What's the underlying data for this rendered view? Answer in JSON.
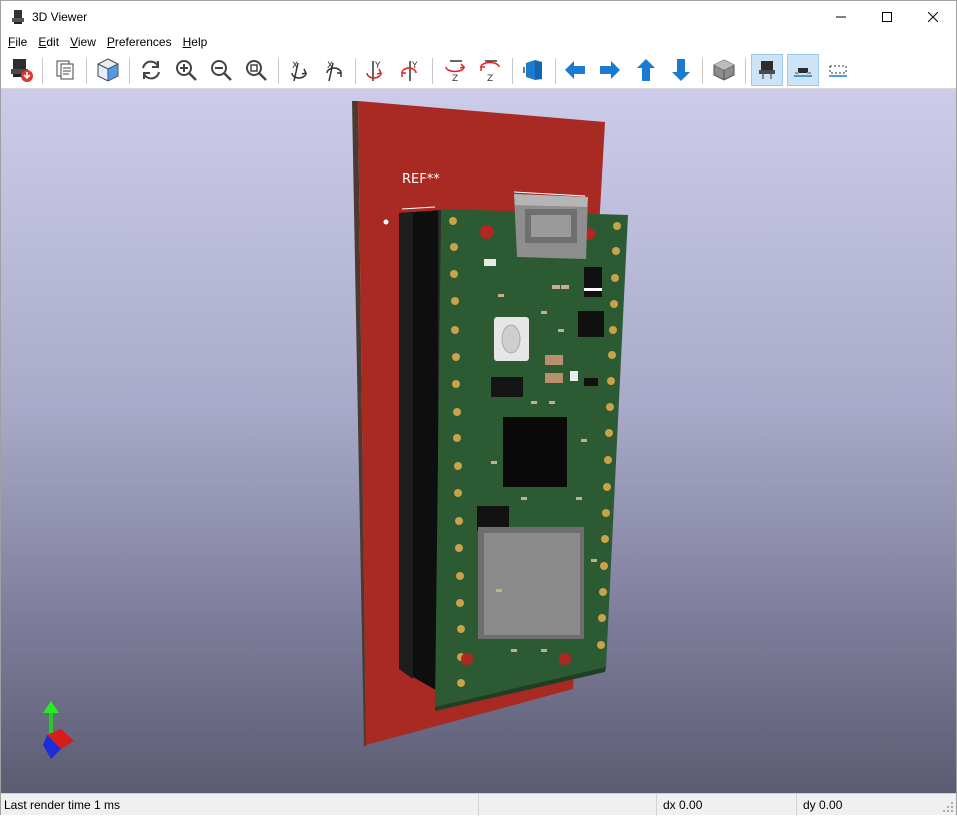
{
  "window": {
    "title": "3D Viewer"
  },
  "menu": {
    "file": {
      "first": "F",
      "rest": "ile"
    },
    "edit": {
      "first": "E",
      "rest": "dit"
    },
    "view": {
      "first": "V",
      "rest": "iew"
    },
    "preferences": {
      "first": "P",
      "rest": "references"
    },
    "help": {
      "first": "H",
      "rest": "elp"
    }
  },
  "toolbar": {
    "icons": [
      "reload-board-icon",
      "copy-image-icon",
      "render-raytraced-icon",
      "refresh-icon",
      "zoom-in-icon",
      "zoom-out-icon",
      "zoom-fit-icon",
      "rotate-x-cw-icon",
      "rotate-x-ccw-icon",
      "rotate-y-cw-icon",
      "rotate-y-ccw-icon",
      "rotate-z-cw-icon",
      "rotate-z-ccw-icon",
      "flip-board-icon",
      "move-left-icon",
      "move-right-icon",
      "move-up-icon",
      "move-down-icon",
      "ortho-toggle-icon",
      "show-tht-icon",
      "show-smd-icon",
      "show-virtual-icon"
    ]
  },
  "board": {
    "silkscreen_ref": "REF**"
  },
  "status": {
    "render_time": "Last render time 1 ms",
    "dx": "dx 0.00",
    "dy": "dy 0.00"
  },
  "colors": {
    "board_red": "#a92a22",
    "pcb_green": "#2c5a33",
    "toolbar_blue": "#1a7cd0",
    "viewport_top": "#ccccea",
    "viewport_bottom": "#5b5b72"
  }
}
